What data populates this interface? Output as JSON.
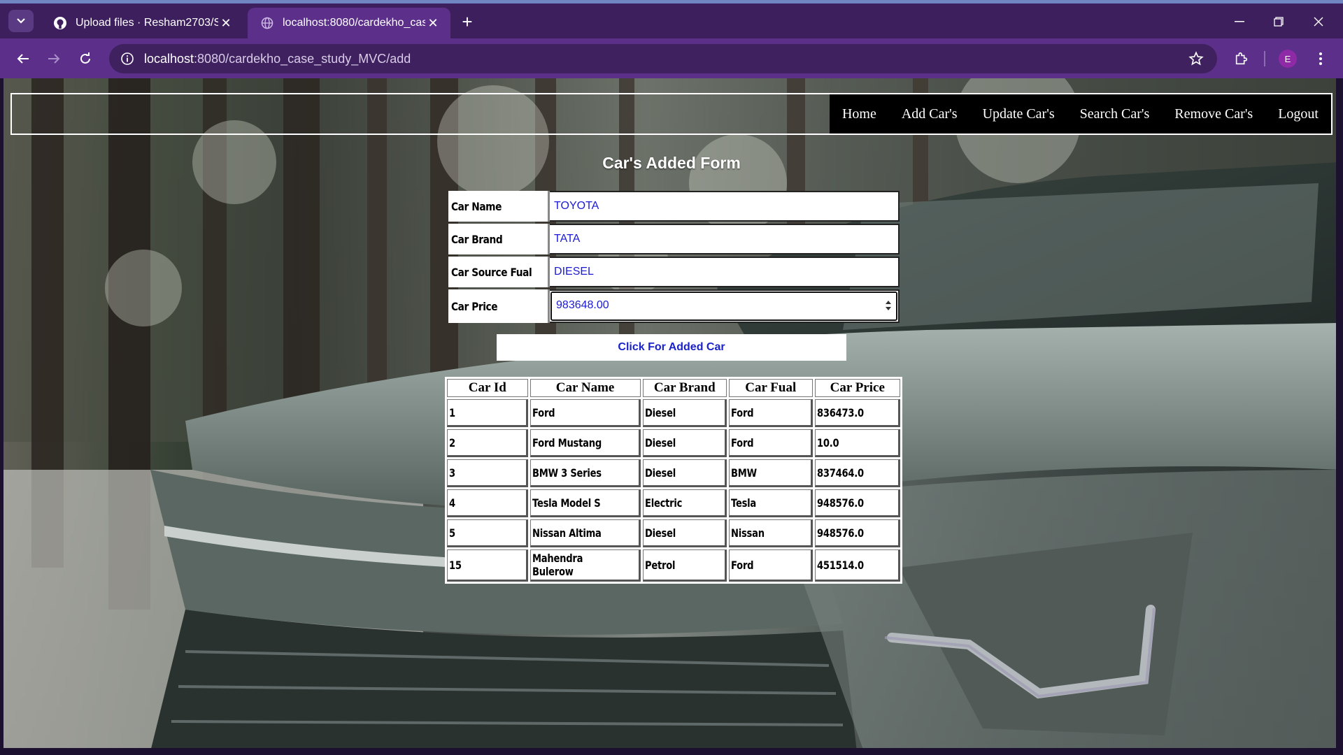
{
  "browser": {
    "tabs": [
      {
        "title": "Upload files · Resham2703/Spr",
        "active": false,
        "icon": "github-icon"
      },
      {
        "title": "localhost:8080/cardekho_case_",
        "active": true,
        "icon": "globe-icon"
      }
    ],
    "url_host": "localhost",
    "url_path": ":8080/cardekho_case_study_MVC/add",
    "profile_initial": "E"
  },
  "nav": {
    "links": [
      "Home",
      "Add Car's",
      "Update Car's",
      "Search Car's",
      "Remove Car's",
      "Logout"
    ]
  },
  "form": {
    "title": "Car's Added Form",
    "fields": [
      {
        "label": "Car Name",
        "value": "TOYOTA"
      },
      {
        "label": "Car Brand",
        "value": "TATA"
      },
      {
        "label": "Car Source Fual",
        "value": "DIESEL"
      },
      {
        "label": "Car Price",
        "value": "983648.00"
      }
    ],
    "submit_label": "Click For Added Car"
  },
  "table": {
    "headers": [
      "Car Id",
      "Car Name",
      "Car Brand",
      "Car Fual",
      "Car Price"
    ],
    "rows": [
      [
        "1",
        "Ford",
        "Diesel",
        "Ford",
        "836473.0"
      ],
      [
        "2",
        "Ford Mustang",
        "Diesel",
        "Ford",
        "10.0"
      ],
      [
        "3",
        "BMW 3 Series",
        "Diesel",
        "BMW",
        "837464.0"
      ],
      [
        "4",
        "Tesla Model S",
        "Electric",
        "Tesla",
        "948576.0"
      ],
      [
        "5",
        "Nissan Altima",
        "Diesel",
        "Nissan",
        "948576.0"
      ],
      [
        "15",
        "Mahendra Bulerow",
        "Petrol",
        "Ford",
        "451514.0"
      ]
    ]
  },
  "colors": {
    "tab_bar": "#3d1f5e",
    "toolbar": "#5b2f8a",
    "input_text": "#1a1ad6",
    "button_text": "#1a22c9",
    "nav_bg": "#000000"
  }
}
